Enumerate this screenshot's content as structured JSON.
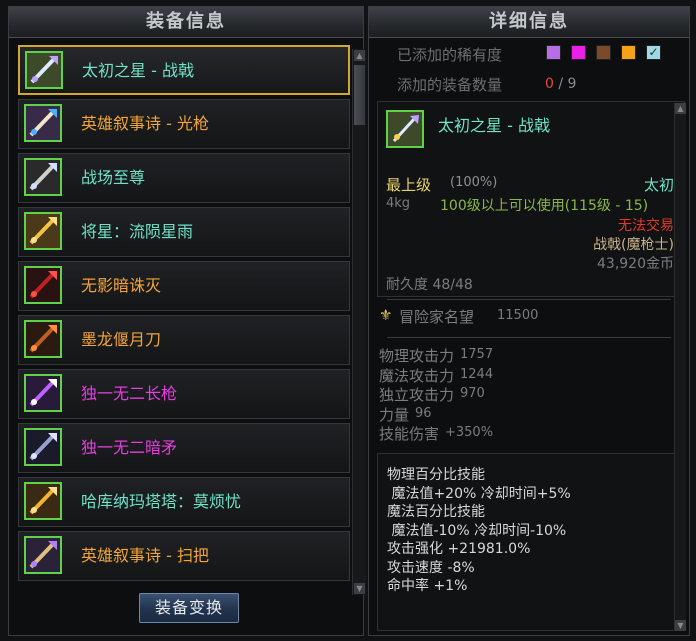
{
  "left_panel": {
    "title": "装备信息",
    "items": [
      {
        "name": "太初之星 - 战戟",
        "color": "#6fe3c8",
        "icon": "halberd-icon",
        "selected": true
      },
      {
        "name": "英雄叙事诗 - 光枪",
        "color": "#f3a43a",
        "icon": "light-spear-icon",
        "selected": false
      },
      {
        "name": "战场至尊",
        "color": "#6fe3c8",
        "icon": "axe-icon",
        "selected": false
      },
      {
        "name": "将星：流陨星雨",
        "color": "#6fe3c8",
        "icon": "star-spear-icon",
        "selected": false
      },
      {
        "name": "无影暗诛灭",
        "color": "#f3a43a",
        "icon": "dark-blade-icon",
        "selected": false
      },
      {
        "name": "墨龙偃月刀",
        "color": "#f3a43a",
        "icon": "dragon-blade-icon",
        "selected": false
      },
      {
        "name": "独一无二长枪",
        "color": "#e63ce0",
        "icon": "long-spear-icon",
        "selected": false
      },
      {
        "name": "独一无二暗矛",
        "color": "#e63ce0",
        "icon": "dark-lance-icon",
        "selected": false
      },
      {
        "name": "哈库纳玛塔塔：莫烦忧",
        "color": "#6fe3c8",
        "icon": "sun-staff-icon",
        "selected": false
      },
      {
        "name": "英雄叙事诗 - 扫把",
        "color": "#f3a43a",
        "icon": "broom-icon",
        "selected": false
      }
    ],
    "switch_button": "装备变换"
  },
  "right_panel": {
    "title": "详细信息",
    "rarity_label": "已添加的稀有度",
    "rarity_colors": [
      "#b56ee6",
      "#e820e8",
      "#7a4a2a",
      "#f5a21b"
    ],
    "count_label": "添加的装备数量",
    "count_current": "0",
    "count_sep": "/",
    "count_max": "9",
    "detail": {
      "name": "太初之星 - 战戟",
      "grade": "最上级",
      "grade_pct": "(100%)",
      "rarity": "太初",
      "weight": "4kg",
      "level_req": "100级以上可以使用(115级 - 15)",
      "trade": "无法交易",
      "type": "战戟(魔枪士)",
      "price": "43,920金币",
      "durability": "耐久度 48/48",
      "fame_label": "冒险家名望",
      "fame_value": "11500",
      "stats": [
        {
          "label": "物理攻击力",
          "value": "1757"
        },
        {
          "label": "魔法攻击力",
          "value": "1244"
        },
        {
          "label": "独立攻击力",
          "value": "970"
        },
        {
          "label": "力量",
          "value": "96"
        },
        {
          "label": "技能伤害",
          "value": "+350%"
        }
      ],
      "effects": [
        "物理百分比技能",
        " 魔法值+20% 冷却时间+5%",
        "魔法百分比技能",
        " 魔法值-10% 冷却时间-10%",
        "攻击强化 +21981.0%",
        "攻击速度 -8%",
        "命中率 +1%"
      ]
    }
  }
}
